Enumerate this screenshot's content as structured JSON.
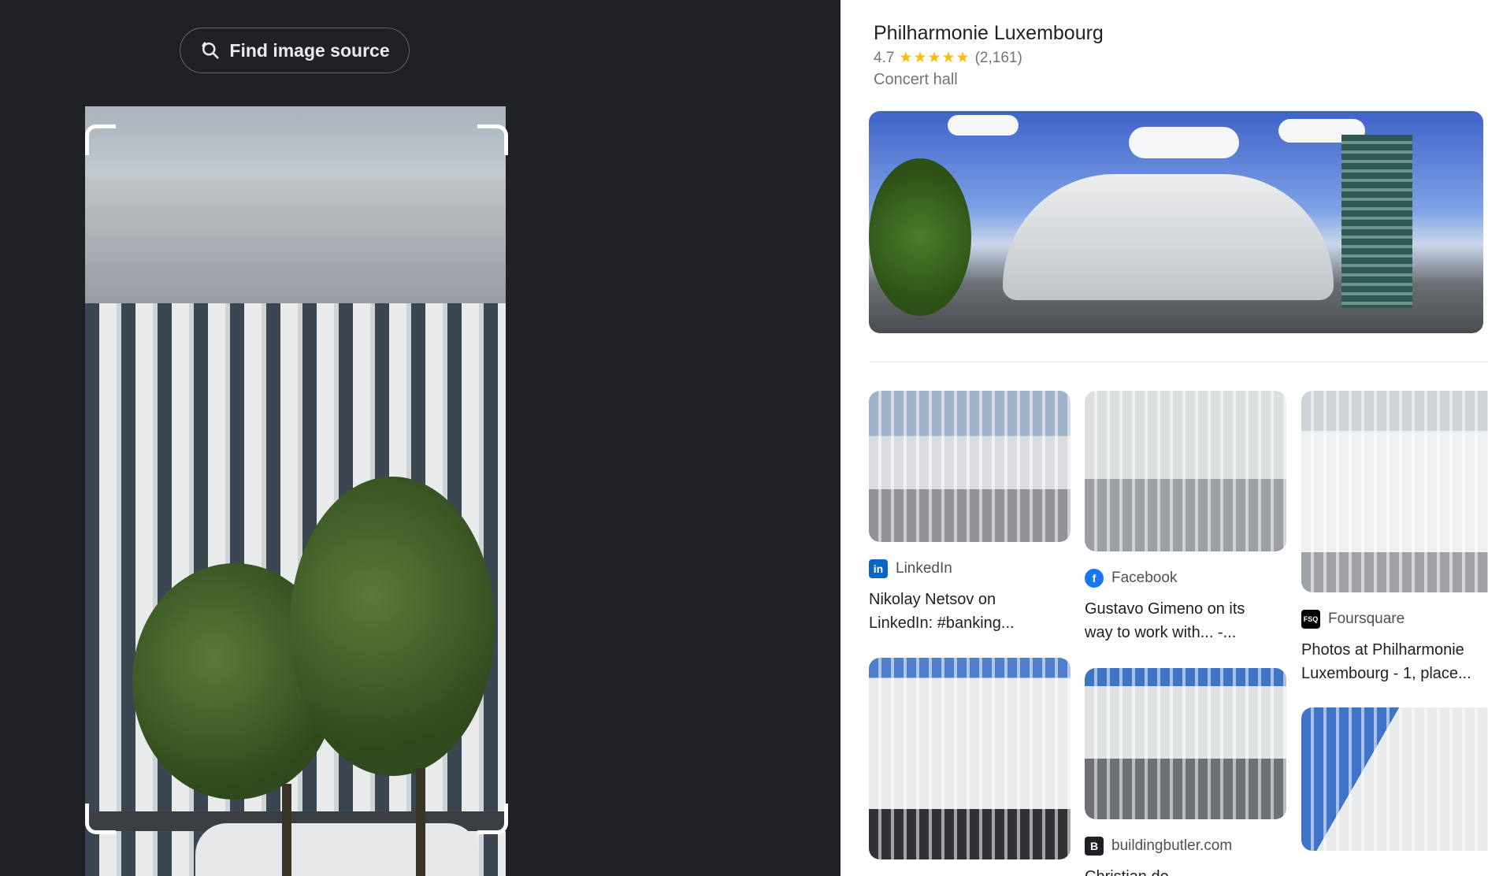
{
  "find_button": {
    "label": "Find image source",
    "icon": "lens-search-icon"
  },
  "place": {
    "title": "Philharmonie Luxembourg",
    "rating": "4.7",
    "stars": "★★★★★",
    "reviews": "(2,161)",
    "category": "Concert hall"
  },
  "results": [
    {
      "source": "LinkedIn",
      "icon_letter": "in",
      "icon_color": "#0a66c2",
      "caption1": "Nikolay Netsov on",
      "caption2": "LinkedIn: #banking..."
    },
    {
      "source": "Facebook",
      "icon_letter": "f",
      "icon_color": "#1877f2",
      "caption1": "Gustavo Gimeno on its",
      "caption2": "way to work with... -..."
    },
    {
      "source": "Foursquare",
      "icon_letter": "FSQ",
      "icon_color": "#000000",
      "caption1": "Photos at Philharmonie",
      "caption2": "Luxembourg - 1, place..."
    },
    {
      "source": "buildingbutler.com",
      "icon_letter": "B",
      "icon_color": "#202124",
      "caption1": "Christian de",
      "caption2": ""
    }
  ]
}
